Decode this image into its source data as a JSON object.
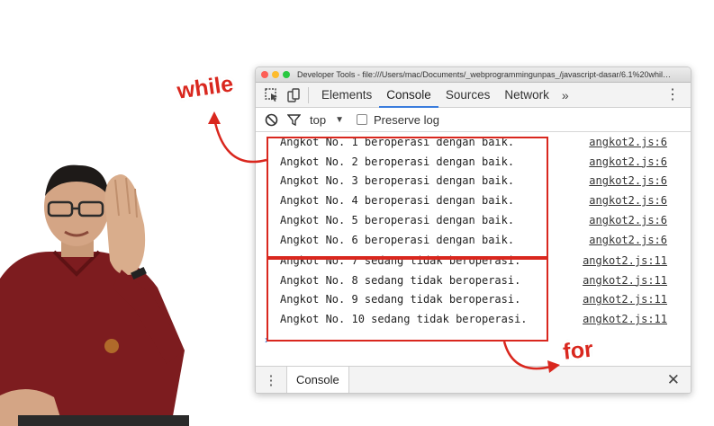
{
  "window": {
    "title": "Developer Tools - file:///Users/mac/Documents/_webprogrammingunpas_/javascript-dasar/6.1%20while/..."
  },
  "tabs": [
    {
      "label": "Elements",
      "active": false
    },
    {
      "label": "Console",
      "active": true
    },
    {
      "label": "Sources",
      "active": false
    },
    {
      "label": "Network",
      "active": false
    }
  ],
  "tabs_more": "»",
  "filter": {
    "context": "top",
    "preserve_log_label": "Preserve log",
    "preserve_log_checked": false
  },
  "console": {
    "rows": [
      {
        "message": "Angkot No. 1 beroperasi dengan baik.",
        "source": "angkot2.js:6"
      },
      {
        "message": "Angkot No. 2 beroperasi dengan baik.",
        "source": "angkot2.js:6"
      },
      {
        "message": "Angkot No. 3 beroperasi dengan baik.",
        "source": "angkot2.js:6"
      },
      {
        "message": "Angkot No. 4 beroperasi dengan baik.",
        "source": "angkot2.js:6"
      },
      {
        "message": "Angkot No. 5 beroperasi dengan baik.",
        "source": "angkot2.js:6"
      },
      {
        "message": "Angkot No. 6 beroperasi dengan baik.",
        "source": "angkot2.js:6"
      },
      {
        "message": "Angkot No. 7 sedang tidak beroperasi.",
        "source": "angkot2.js:11"
      },
      {
        "message": "Angkot No. 8 sedang tidak beroperasi.",
        "source": "angkot2.js:11"
      },
      {
        "message": "Angkot No. 9 sedang tidak beroperasi.",
        "source": "angkot2.js:11"
      },
      {
        "message": "Angkot No. 10 sedang tidak beroperasi.",
        "source": "angkot2.js:11"
      }
    ],
    "prompt": "›"
  },
  "drawer": {
    "tab_label": "Console"
  },
  "annotations": {
    "while_label": "while",
    "for_label": "for",
    "color": "#d9271e"
  },
  "colors": {
    "accent": "#3b7ddd",
    "annotation_red": "#d9271e"
  }
}
